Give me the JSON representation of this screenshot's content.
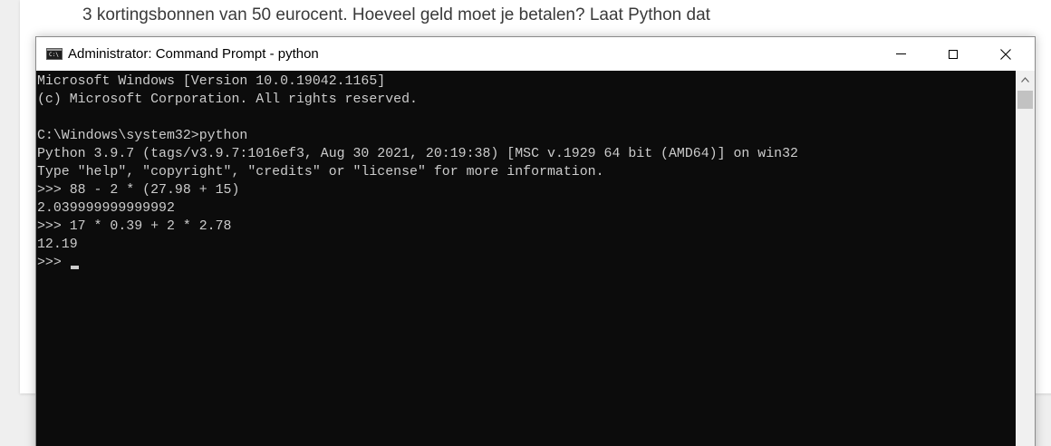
{
  "background_doc": {
    "text_line": "3 kortingsbonnen van 50 eurocent. Hoeveel geld moet je betalen? Laat Python dat"
  },
  "window": {
    "title": "Administrator: Command Prompt - python",
    "icon": "cmd-app-icon",
    "icon_label": "C:\\",
    "controls": {
      "minimize": "minimize-icon",
      "maximize": "maximize-icon",
      "close": "close-icon"
    }
  },
  "console": {
    "lines": [
      "Microsoft Windows [Version 10.0.19042.1165]",
      "(c) Microsoft Corporation. All rights reserved.",
      "",
      "C:\\Windows\\system32>python",
      "Python 3.9.7 (tags/v3.9.7:1016ef3, Aug 30 2021, 20:19:38) [MSC v.1929 64 bit (AMD64)] on win32",
      "Type \"help\", \"copyright\", \"credits\" or \"license\" for more information.",
      ">>> 88 - 2 * (27.98 + 15)",
      "2.039999999999992",
      ">>> 17 * 0.39 + 2 * 2.78",
      "12.19"
    ],
    "prompt": ">>> "
  },
  "colors": {
    "console_bg": "#0c0c0c",
    "console_fg": "#cccccc",
    "titlebar_bg": "#ffffff"
  }
}
